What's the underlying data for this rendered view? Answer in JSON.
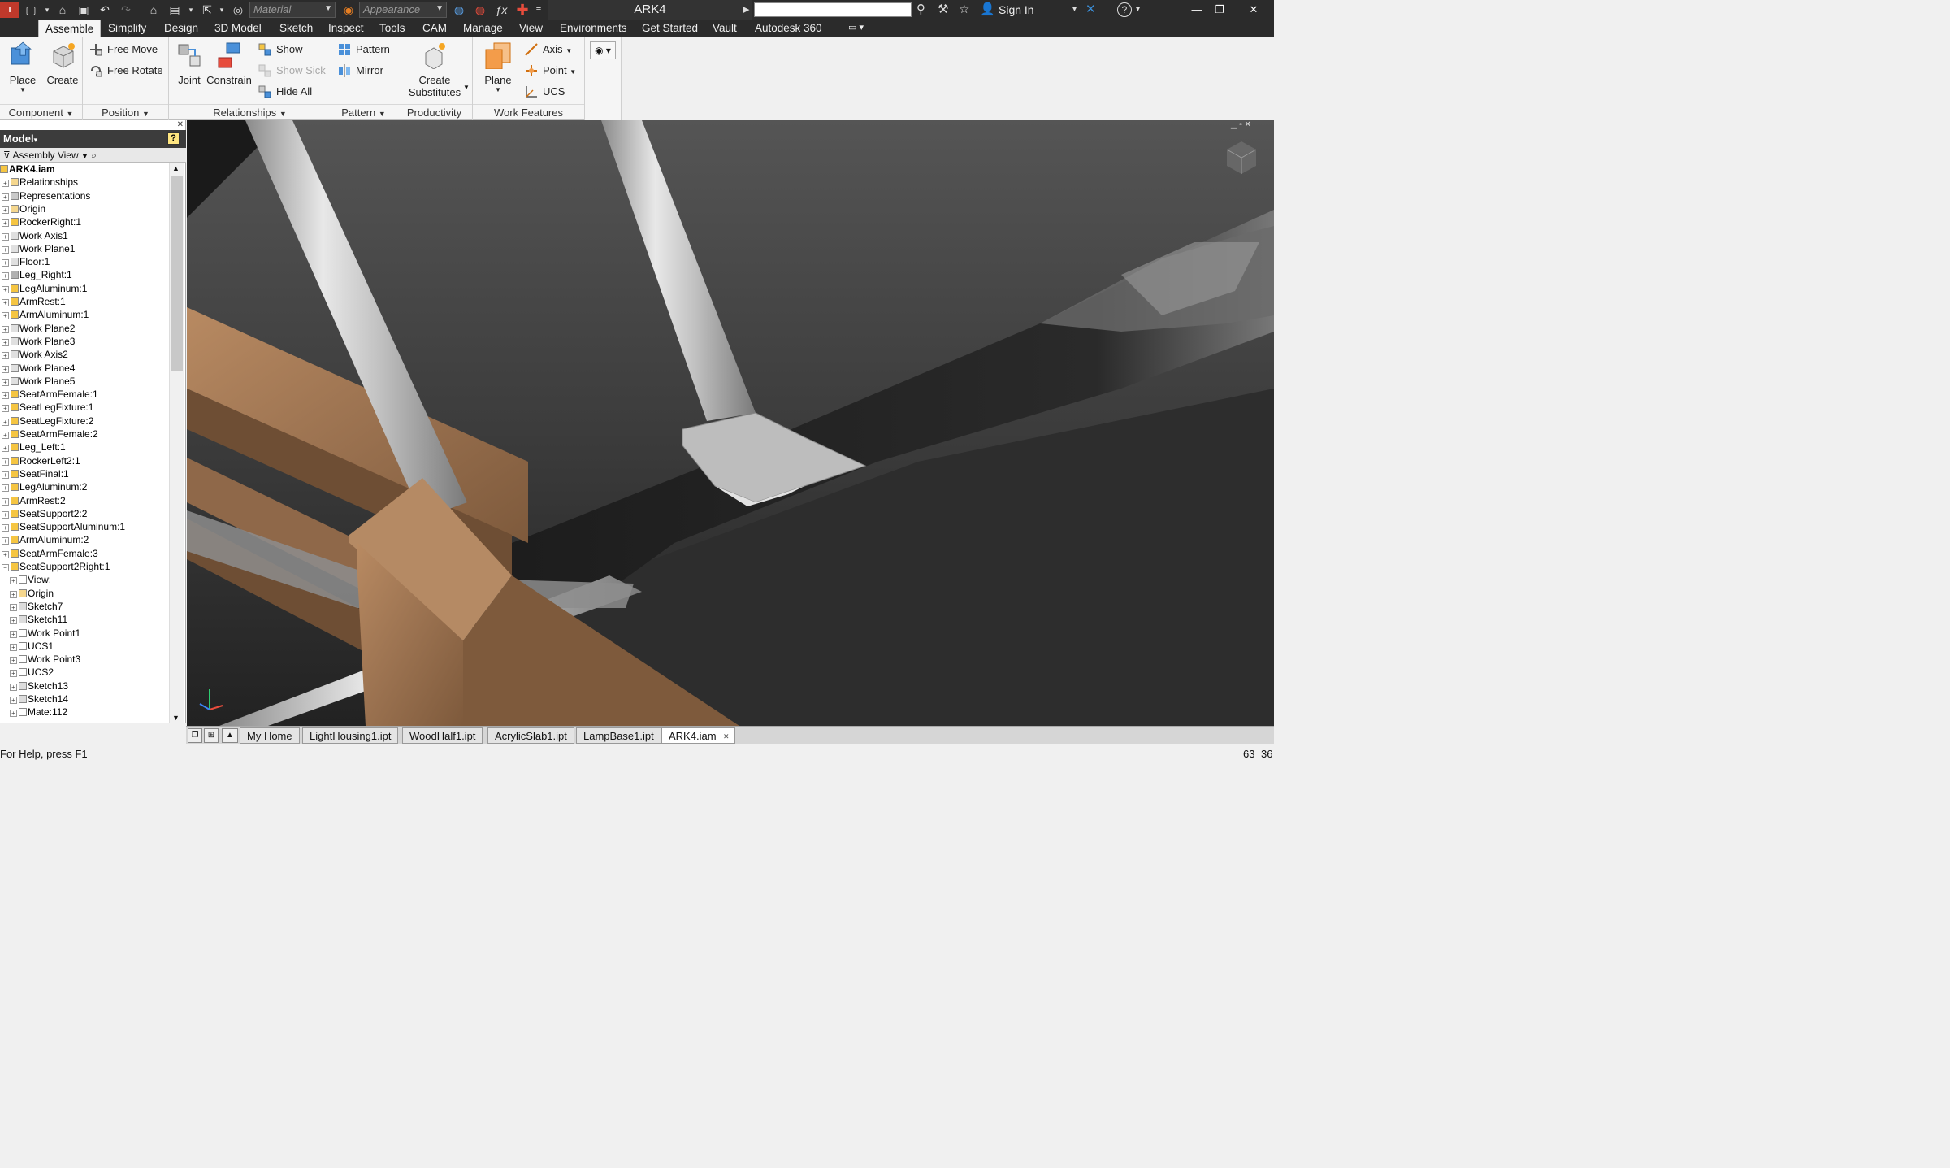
{
  "titlebar": {
    "material_combo": "Material",
    "appearance_combo": "Appearance",
    "document_title": "ARK4",
    "signin_label": "Sign In"
  },
  "ribbon_tabs": [
    "Assemble",
    "Simplify",
    "Design",
    "3D Model",
    "Sketch",
    "Inspect",
    "Tools",
    "CAM",
    "Manage",
    "View",
    "Environments",
    "Get Started",
    "Vault",
    "Autodesk 360"
  ],
  "ribbon": {
    "component": {
      "title": "Component",
      "place": "Place",
      "create": "Create"
    },
    "position": {
      "title": "Position",
      "free_move": "Free Move",
      "free_rotate": "Free Rotate"
    },
    "relationships": {
      "title": "Relationships",
      "joint": "Joint",
      "constrain": "Constrain",
      "show": "Show",
      "show_sick": "Show Sick",
      "hide_all": "Hide All"
    },
    "pattern": {
      "title": "Pattern",
      "pattern": "Pattern",
      "mirror": "Mirror"
    },
    "productivity": {
      "title": "Productivity",
      "create_substitutes_1": "Create",
      "create_substitutes_2": "Substitutes"
    },
    "work_features": {
      "title": "Work Features",
      "plane": "Plane",
      "axis": "Axis",
      "point": "Point",
      "ucs": "UCS"
    }
  },
  "browser": {
    "title": "Model",
    "view_label": "Assembly View",
    "help": "?",
    "nodes": [
      {
        "label": "ARK4.iam",
        "level": 0,
        "icon": "asm"
      },
      {
        "label": "Relationships",
        "level": 1,
        "icon": "folder"
      },
      {
        "label": "Representations",
        "level": 1,
        "icon": "rep"
      },
      {
        "label": "Origin",
        "level": 1,
        "icon": "folder"
      },
      {
        "label": "RockerRight:1",
        "level": 1,
        "icon": "part"
      },
      {
        "label": "Work Axis1",
        "level": 1,
        "icon": "work"
      },
      {
        "label": "Work Plane1",
        "level": 1,
        "icon": "work"
      },
      {
        "label": "Floor:1",
        "level": 1,
        "icon": "work"
      },
      {
        "label": "Leg_Right:1",
        "level": 1,
        "icon": "part2"
      },
      {
        "label": "LegAluminum:1",
        "level": 1,
        "icon": "part"
      },
      {
        "label": "ArmRest:1",
        "level": 1,
        "icon": "part"
      },
      {
        "label": "ArmAluminum:1",
        "level": 1,
        "icon": "part"
      },
      {
        "label": "Work Plane2",
        "level": 1,
        "icon": "work"
      },
      {
        "label": "Work Plane3",
        "level": 1,
        "icon": "work"
      },
      {
        "label": "Work Axis2",
        "level": 1,
        "icon": "work"
      },
      {
        "label": "Work Plane4",
        "level": 1,
        "icon": "work"
      },
      {
        "label": "Work Plane5",
        "level": 1,
        "icon": "work"
      },
      {
        "label": "SeatArmFemale:1",
        "level": 1,
        "icon": "part"
      },
      {
        "label": "SeatLegFixture:1",
        "level": 1,
        "icon": "part"
      },
      {
        "label": "SeatLegFixture:2",
        "level": 1,
        "icon": "part"
      },
      {
        "label": "SeatArmFemale:2",
        "level": 1,
        "icon": "part"
      },
      {
        "label": "Leg_Left:1",
        "level": 1,
        "icon": "part"
      },
      {
        "label": "RockerLeft2:1",
        "level": 1,
        "icon": "part"
      },
      {
        "label": "SeatFinal:1",
        "level": 1,
        "icon": "part"
      },
      {
        "label": "LegAluminum:2",
        "level": 1,
        "icon": "part"
      },
      {
        "label": "ArmRest:2",
        "level": 1,
        "icon": "part"
      },
      {
        "label": "SeatSupport2:2",
        "level": 1,
        "icon": "part"
      },
      {
        "label": "SeatSupportAluminum:1",
        "level": 1,
        "icon": "part"
      },
      {
        "label": "ArmAluminum:2",
        "level": 1,
        "icon": "part"
      },
      {
        "label": "SeatArmFemale:3",
        "level": 1,
        "icon": "part"
      },
      {
        "label": "SeatSupport2Right:1",
        "level": 1,
        "icon": "part",
        "expanded": true
      },
      {
        "label": "View:",
        "level": 2,
        "icon": "view"
      },
      {
        "label": "Origin",
        "level": 2,
        "icon": "folder"
      },
      {
        "label": "Sketch7",
        "level": 2,
        "icon": "sketch"
      },
      {
        "label": "Sketch11",
        "level": 2,
        "icon": "sketch"
      },
      {
        "label": "Work Point1",
        "level": 2,
        "icon": "point"
      },
      {
        "label": "UCS1",
        "level": 2,
        "icon": "ucs"
      },
      {
        "label": "Work Point3",
        "level": 2,
        "icon": "point"
      },
      {
        "label": "UCS2",
        "level": 2,
        "icon": "ucs"
      },
      {
        "label": "Sketch13",
        "level": 2,
        "icon": "sketch"
      },
      {
        "label": "Sketch14",
        "level": 2,
        "icon": "sketch"
      },
      {
        "label": "Mate:112",
        "level": 2,
        "icon": "mate"
      }
    ]
  },
  "doc_tabs": [
    "My Home",
    "LightHousing1.ipt",
    "WoodHalf1.ipt",
    "AcrylicSlab1.ipt",
    "LampBase1.ipt",
    "ARK4.iam"
  ],
  "active_doc_tab": "ARK4.iam",
  "status": {
    "help": "For Help, press F1",
    "count1": "63",
    "count2": "36"
  },
  "colors": {
    "accent": "#1e73be",
    "wood": "#a57a55",
    "aluminum": "#c2c2c2",
    "dark_bg": "#2b2b2b"
  }
}
